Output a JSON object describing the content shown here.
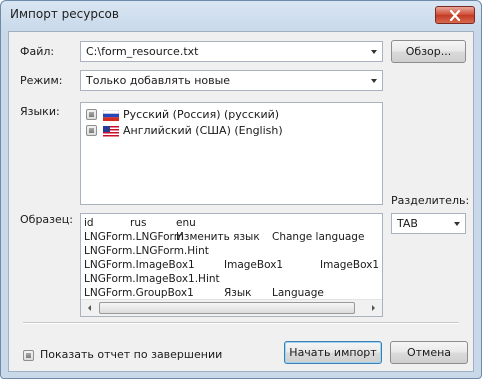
{
  "window": {
    "title": "Импорт ресурсов",
    "close_icon": "close-icon"
  },
  "form": {
    "file_label": "Файл:",
    "file_value": "C:\\form_resource.txt",
    "browse_label": "Обзор...",
    "mode_label": "Режим:",
    "mode_value": "Только добавлять новые",
    "languages_label": "Языки:",
    "languages": [
      {
        "label": "Русский (Россия) (русский)",
        "flag": "russia-flag-icon",
        "checked": false
      },
      {
        "label": "Английский (США) (English)",
        "flag": "usa-flag-icon",
        "checked": false
      }
    ],
    "separator_label": "Разделитель:",
    "separator_value": "TAB",
    "sample_label": "Образец:",
    "sample_rows": [
      [
        "id",
        "rus",
        "enu"
      ],
      [
        "LNGForm.LNGForm",
        "Изменить язык",
        "Change language"
      ],
      [
        "LNGForm.LNGForm.Hint",
        "",
        ""
      ],
      [
        "LNGForm.ImageBox1",
        "ImageBox1",
        "ImageBox1"
      ],
      [
        "LNGForm.ImageBox1.Hint",
        "",
        ""
      ],
      [
        "LNGForm.GroupBox1",
        "Язык",
        "Language"
      ]
    ]
  },
  "footer": {
    "show_report_label": "Показать отчет по завершении",
    "show_report_checked": false,
    "start_button": "Начать импорт",
    "cancel_button": "Отмена"
  },
  "colors": {
    "title_bg": "#c9d9ea",
    "client_bg": "#f0f0f0",
    "default_button_border": "#3c7fb1",
    "close_button": "#c13a24"
  }
}
